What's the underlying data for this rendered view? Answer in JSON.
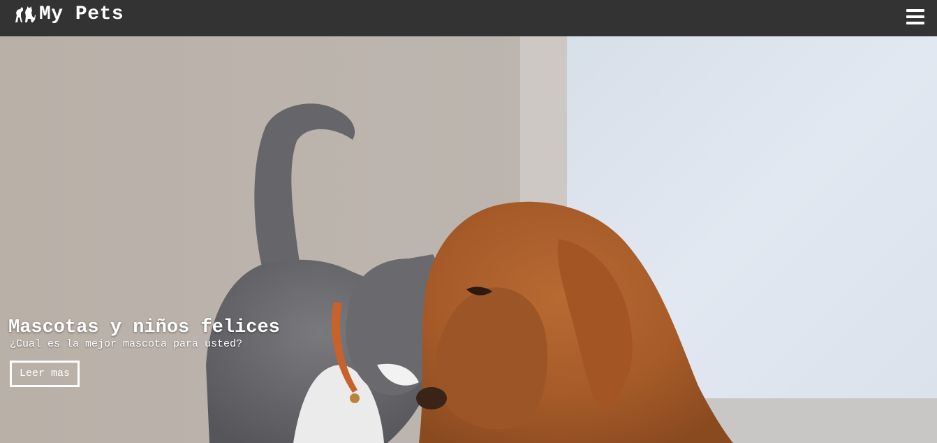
{
  "navbar": {
    "brand_icon": "pets-icon",
    "brand_text": "My Pets",
    "menu_icon": "hamburger-menu-icon"
  },
  "hero": {
    "image": "cat-and-dog-photo",
    "title": "Mascotas y niños felices",
    "subtitle": "¿Cual es la mejor mascota para usted?",
    "button_label": "Leer mas"
  },
  "colors": {
    "navbar_bg": "#333333",
    "text": "#ffffff"
  }
}
